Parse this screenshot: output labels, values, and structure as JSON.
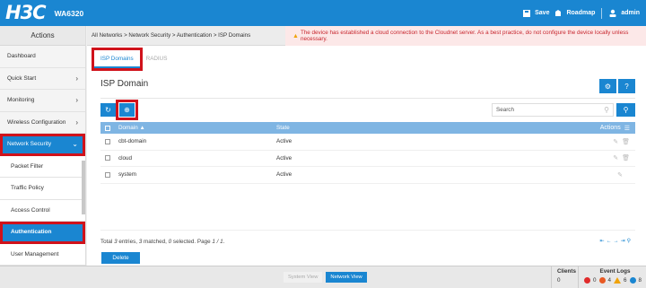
{
  "app": {
    "logo": "H3C",
    "model": "WA6320"
  },
  "topbar": {
    "save": "Save",
    "roadmap": "Roadmap",
    "user": "admin"
  },
  "sidebar": {
    "title": "Actions",
    "items": [
      {
        "label": "Dashboard",
        "chevron": ""
      },
      {
        "label": "Quick Start",
        "chevron": "›"
      },
      {
        "label": "Monitoring",
        "chevron": "›"
      },
      {
        "label": "Wireless Configuration",
        "chevron": "›"
      },
      {
        "label": "Network Security",
        "chevron": "⌄"
      }
    ],
    "subitems": [
      {
        "label": "Packet Filter"
      },
      {
        "label": "Traffic Policy"
      },
      {
        "label": "Access Control"
      },
      {
        "label": "Authentication"
      },
      {
        "label": "User Management"
      }
    ]
  },
  "breadcrumb": "All Networks > Network Security > Authentication > ISP Domains",
  "warning": "The device has established a cloud connection to the Cloudnet server. As a best practice, do not configure the device locally unless necessary.",
  "tabs": [
    {
      "label": "ISP Domains"
    },
    {
      "label": "RADIUS"
    }
  ],
  "page_title": "ISP Domain",
  "search_placeholder": "Search",
  "table": {
    "headers": {
      "domain": "Domain",
      "state": "State",
      "actions": "Actions"
    },
    "rows": [
      {
        "domain": "cbt-domain",
        "state": "Active"
      },
      {
        "domain": "cloud",
        "state": "Active"
      },
      {
        "domain": "system",
        "state": "Active"
      }
    ]
  },
  "footer": {
    "total_prefix": "Total ",
    "total": "3",
    "entries": " entries, ",
    "matched": "3",
    "matched_label": " matched, ",
    "selected": "0",
    "selected_label": " selected. Page ",
    "page": "1 / 1",
    "page_suffix": "."
  },
  "delete_label": "Delete",
  "status": {
    "system_view": "System View",
    "network_view": "Network View",
    "clients_label": "Clients",
    "clients_value": "0",
    "event_logs_label": "Event Logs",
    "critical": "0",
    "major": "4",
    "minor": "6",
    "info": "8"
  },
  "colors": {
    "accent": "#1a86d1",
    "warning_text": "#c7262e",
    "highlight": "#d0121b"
  }
}
